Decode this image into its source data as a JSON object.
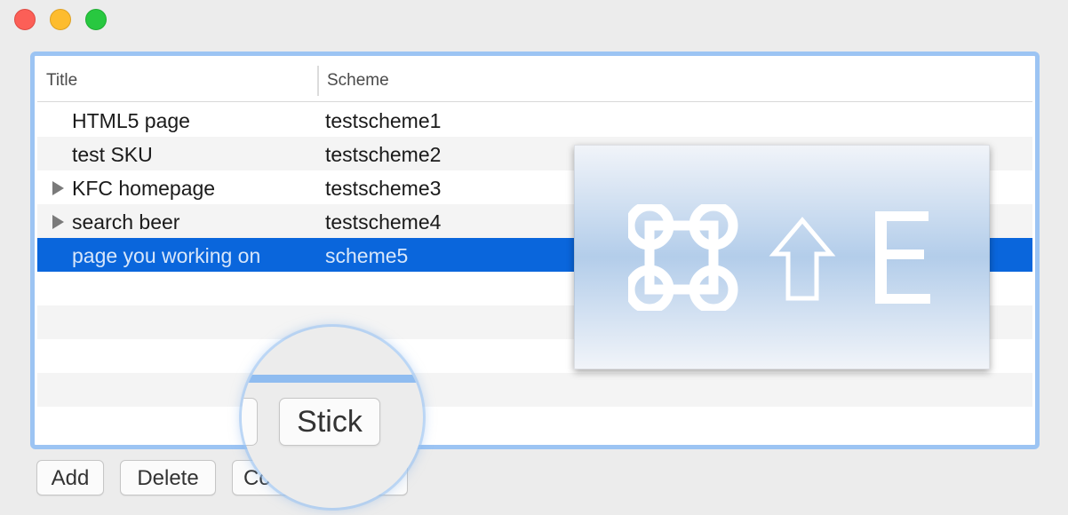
{
  "window": {
    "traffic_lights": [
      "close",
      "minimize",
      "zoom"
    ]
  },
  "table": {
    "columns": [
      "Title",
      "Scheme"
    ],
    "rows": [
      {
        "title": "HTML5 page",
        "scheme": "testscheme1",
        "expandable": false
      },
      {
        "title": "test SKU",
        "scheme": "testscheme2",
        "expandable": false
      },
      {
        "title": "KFC homepage",
        "scheme": "testscheme3",
        "expandable": true
      },
      {
        "title": "search beer",
        "scheme": "testscheme4",
        "expandable": true
      },
      {
        "title": "page you working on",
        "scheme": "scheme5",
        "expandable": false,
        "selected": true
      }
    ],
    "selection_color": "#0a66dc",
    "focus_ring_color": "#9cc4f3"
  },
  "buttons": {
    "add": "Add",
    "delete": "Delete",
    "copy_partial": "Co"
  },
  "magnifier": {
    "button_label": "Stick"
  },
  "shortcut_hud": {
    "keys": [
      "command-icon",
      "shift-icon",
      "E"
    ]
  }
}
